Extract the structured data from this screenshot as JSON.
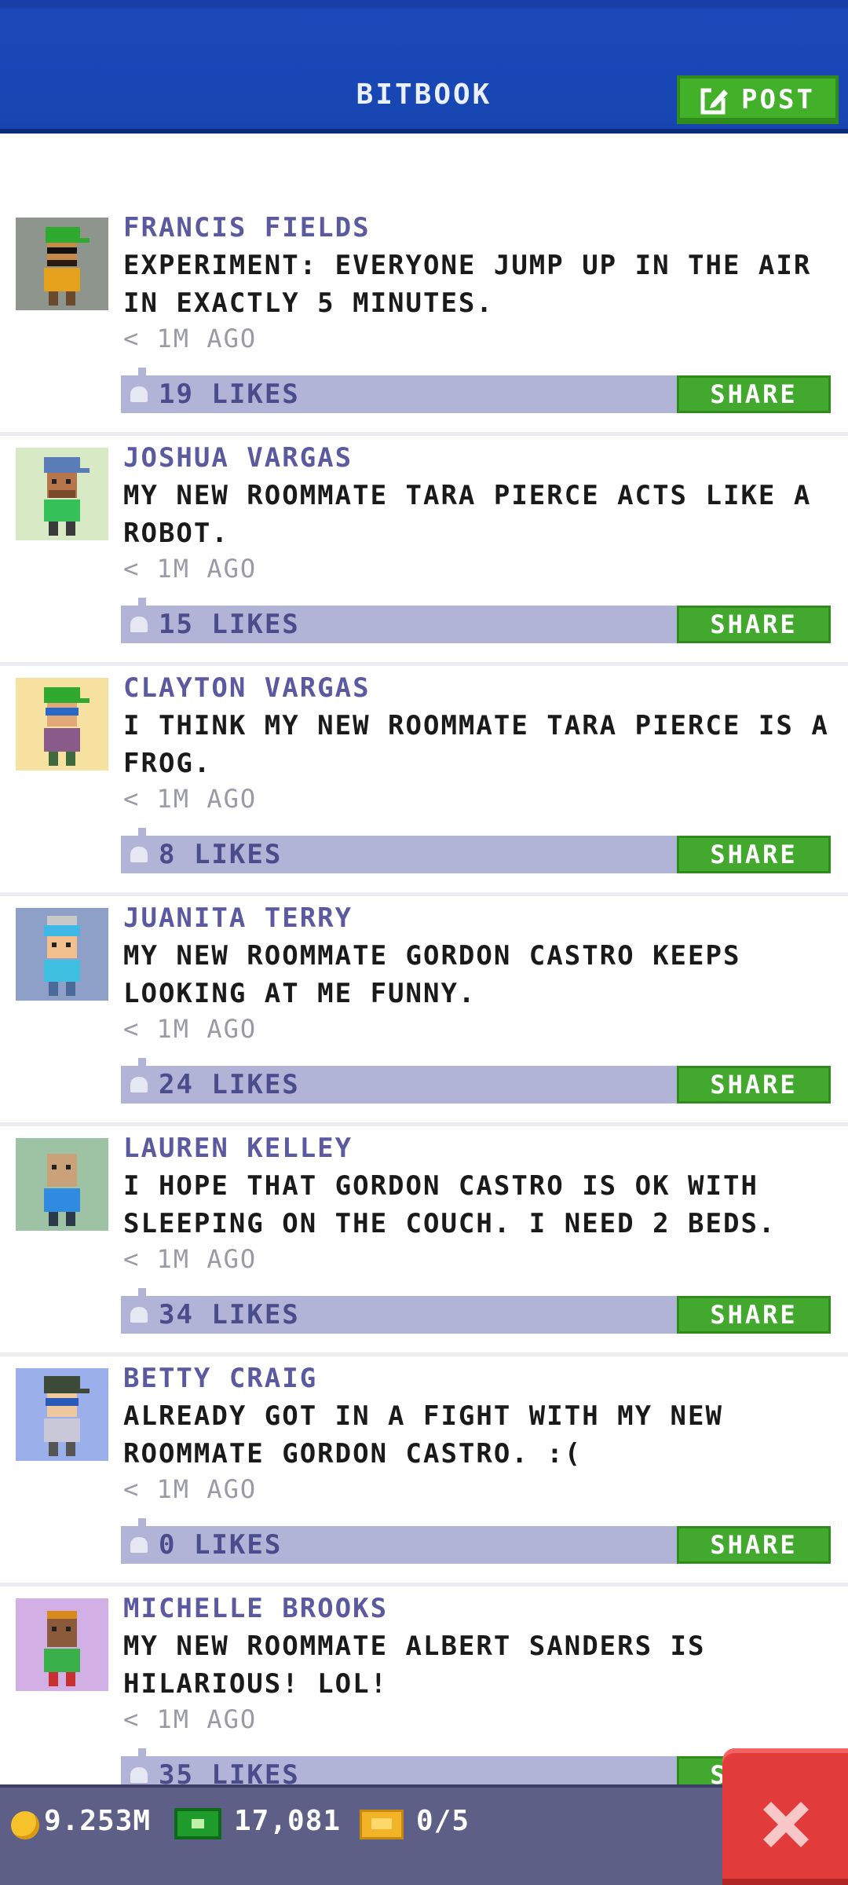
{
  "header": {
    "title": "BITBOOK",
    "post_label": "POST"
  },
  "posts": [
    {
      "author": "FRANCIS FIELDS",
      "message": "EXPERIMENT: EVERYONE JUMP UP IN THE AIR IN EXACTLY 5 MINUTES.",
      "time": "< 1M AGO",
      "likes": "19 LIKES",
      "share": "SHARE",
      "avatar_bg": "#8e958c"
    },
    {
      "author": "JOSHUA VARGAS",
      "message": "MY NEW ROOMMATE TARA PIERCE ACTS LIKE A ROBOT.",
      "time": "< 1M AGO",
      "likes": "15 LIKES",
      "share": "SHARE",
      "avatar_bg": "#d8e9c6"
    },
    {
      "author": "CLAYTON VARGAS",
      "message": "I THINK MY NEW ROOMMATE TARA PIERCE IS A FROG.",
      "time": "< 1M AGO",
      "likes": "8 LIKES",
      "share": "SHARE",
      "avatar_bg": "#f7e1a0"
    },
    {
      "author": "JUANITA TERRY",
      "message": "MY NEW ROOMMATE GORDON CASTRO KEEPS LOOKING AT ME FUNNY.",
      "time": "< 1M AGO",
      "likes": "24 LIKES",
      "share": "SHARE",
      "avatar_bg": "#8fa0c8"
    },
    {
      "author": "LAUREN KELLEY",
      "message": "I HOPE THAT GORDON CASTRO IS OK WITH SLEEPING ON THE COUCH. I NEED 2 BEDS.",
      "time": "< 1M AGO",
      "likes": "34 LIKES",
      "share": "SHARE",
      "avatar_bg": "#9ec3a4"
    },
    {
      "author": "BETTY CRAIG",
      "message": "ALREADY GOT IN A FIGHT WITH MY NEW ROOMMATE GORDON CASTRO. :(",
      "time": "< 1M AGO",
      "likes": "0 LIKES",
      "share": "SHARE",
      "avatar_bg": "#9bb0ea"
    },
    {
      "author": "MICHELLE BROOKS",
      "message": "MY NEW ROOMMATE ALBERT SANDERS IS HILARIOUS! LOL!",
      "time": "< 1M AGO",
      "likes": "35 LIKES",
      "share": "SHARE",
      "avatar_bg": "#d2b0e6"
    }
  ],
  "status_bar": {
    "coins": "9.253M",
    "bux": "17,081",
    "tickets": "0/5"
  },
  "icons": {
    "post": "edit-icon",
    "like": "thumbs-up-icon",
    "coins": "coin-icon",
    "bux": "bux-icon",
    "tickets": "ticket-icon",
    "close": "close-icon"
  },
  "colors": {
    "header_blue": "#1846b5",
    "action_green": "#43a92e",
    "likes_bar": "#b2b4d7",
    "author_purple": "#5b5aa0",
    "close_red": "#e23b3b"
  }
}
